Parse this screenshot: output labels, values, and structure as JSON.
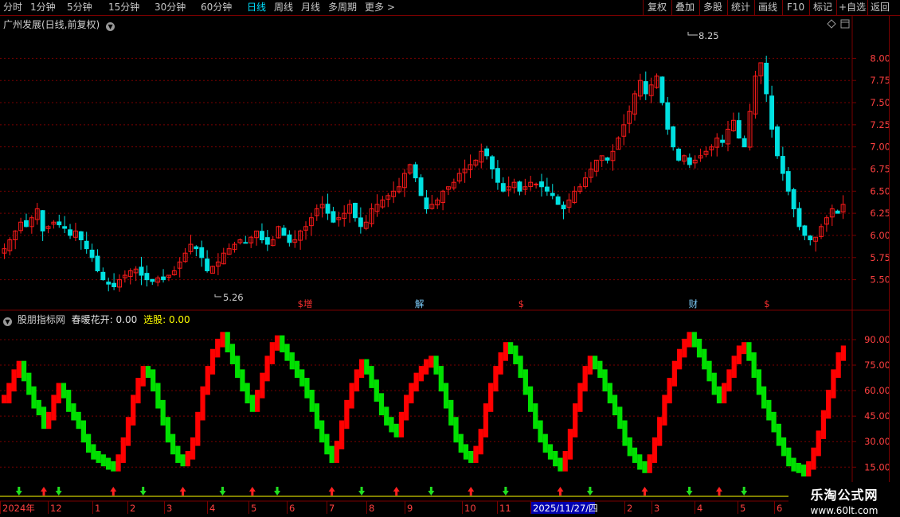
{
  "toolbar": {
    "periods": [
      "分时",
      "1分钟",
      "5分钟",
      "15分钟",
      "30分钟",
      "60分钟",
      "日线",
      "周线",
      "月线",
      "多周期",
      "更多"
    ],
    "active_period": "日线",
    "more_chevron": ">",
    "right_buttons": [
      "复权",
      "叠加",
      "多股",
      "统计",
      "画线",
      "F10",
      "标记",
      "+自选",
      "返回"
    ]
  },
  "price_chart": {
    "title": "广州发展(日线,前复权)",
    "y_ticks": [
      "8.00",
      "7.75",
      "7.50",
      "7.25",
      "7.00",
      "6.75",
      "6.50",
      "6.25",
      "6.00",
      "5.75",
      "5.50"
    ],
    "high_label": "8.25",
    "low_label": "5.26",
    "event_markers": [
      {
        "text": "$增",
        "pos": 0.36
      },
      {
        "text": "解",
        "pos": 0.495
      },
      {
        "text": "$",
        "pos": 0.615
      },
      {
        "text": "财",
        "pos": 0.818
      },
      {
        "text": "$",
        "pos": 0.905
      }
    ]
  },
  "indicator": {
    "name": "股朋指标网",
    "series_label": "春暖花开",
    "series_value": "0.00",
    "select_label": "选股",
    "select_value": "0.00",
    "y_ticks": [
      "90.00",
      "75.00",
      "60.00",
      "45.00",
      "30.00",
      "15.00"
    ]
  },
  "time_axis": {
    "labels": [
      "2024年",
      "12",
      "1",
      "2",
      "3",
      "4",
      "5",
      "6",
      "7",
      "8",
      "9",
      "10",
      "11",
      "2025/11/27/四",
      "2",
      "3",
      "4",
      "5",
      "6"
    ],
    "highlighted": "2025/11/27/四"
  },
  "watermark": {
    "title": "乐淘公式网",
    "url": "www.60lt.com"
  },
  "colors": {
    "up": "#ff1a1a",
    "down": "#00e0e0",
    "ind_up": "#ff0000",
    "ind_down": "#00e000",
    "grid": "#7a0000",
    "axis_text": "#ff4040",
    "active": "#00e0ff"
  },
  "chart_data": [
    {
      "type": "candlestick",
      "title": "广州发展(日线,前复权)",
      "ylim": [
        5.2,
        8.3
      ],
      "y_ticks": [
        5.5,
        5.75,
        6.0,
        6.25,
        6.5,
        6.75,
        7.0,
        7.25,
        7.5,
        7.75,
        8.0
      ],
      "annotations": [
        {
          "label": "8.25",
          "value": 8.25,
          "kind": "high"
        },
        {
          "label": "5.26",
          "value": 5.26,
          "kind": "low"
        }
      ],
      "close_series": [
        5.85,
        5.95,
        6.05,
        6.15,
        6.1,
        6.2,
        6.3,
        6.05,
        6.1,
        6.15,
        6.12,
        6.08,
        6.0,
        6.05,
        5.95,
        5.85,
        5.75,
        5.6,
        5.5,
        5.45,
        5.42,
        5.5,
        5.55,
        5.6,
        5.62,
        5.55,
        5.5,
        5.48,
        5.52,
        5.5,
        5.55,
        5.6,
        5.7,
        5.8,
        5.9,
        5.85,
        5.75,
        5.6,
        5.65,
        5.7,
        5.8,
        5.85,
        5.9,
        5.95,
        5.92,
        5.98,
        6.05,
        5.95,
        5.9,
        5.95,
        6.1,
        6.0,
        5.92,
        5.95,
        6.05,
        6.1,
        6.2,
        6.3,
        6.35,
        6.25,
        6.15,
        6.2,
        6.25,
        6.35,
        6.2,
        6.1,
        6.15,
        6.3,
        6.35,
        6.4,
        6.45,
        6.5,
        6.55,
        6.7,
        6.8,
        6.65,
        6.45,
        6.3,
        6.35,
        6.4,
        6.5,
        6.55,
        6.6,
        6.7,
        6.75,
        6.8,
        6.85,
        6.95,
        6.9,
        6.75,
        6.6,
        6.5,
        6.55,
        6.6,
        6.5,
        6.55,
        6.6,
        6.58,
        6.55,
        6.5,
        6.45,
        6.35,
        6.3,
        6.4,
        6.5,
        6.55,
        6.65,
        6.75,
        6.85,
        6.9,
        6.85,
        6.95,
        7.1,
        7.25,
        7.4,
        7.6,
        7.75,
        7.6,
        7.7,
        7.8,
        7.5,
        7.2,
        7.0,
        6.85,
        6.9,
        6.8,
        6.85,
        6.9,
        6.95,
        7.0,
        7.1,
        7.05,
        7.2,
        7.3,
        7.1,
        7.0,
        7.4,
        7.8,
        7.95,
        7.6,
        7.2,
        6.9,
        6.7,
        6.5,
        6.3,
        6.1,
        6.0,
        5.95,
        5.98,
        6.1,
        6.2,
        6.3,
        6.25,
        6.35
      ]
    },
    {
      "type": "line",
      "title": "股朋指标网",
      "ylim": [
        10,
        97
      ],
      "y_ticks": [
        15,
        30,
        45,
        60,
        75,
        90
      ],
      "series": [
        {
          "name": "春暖花开",
          "values": [
            55,
            62,
            70,
            75,
            68,
            60,
            52,
            48,
            40,
            45,
            55,
            62,
            58,
            50,
            45,
            40,
            32,
            26,
            22,
            20,
            18,
            16,
            15,
            20,
            30,
            42,
            55,
            65,
            72,
            70,
            62,
            52,
            42,
            32,
            25,
            20,
            18,
            22,
            30,
            45,
            60,
            72,
            82,
            88,
            92,
            85,
            78,
            70,
            62,
            55,
            50,
            58,
            68,
            78,
            86,
            90,
            85,
            80,
            75,
            70,
            65,
            58,
            50,
            40,
            32,
            25,
            20,
            28,
            40,
            52,
            62,
            70,
            76,
            72,
            64,
            56,
            48,
            42,
            38,
            35,
            45,
            55,
            62,
            68,
            72,
            76,
            78,
            72,
            62,
            52,
            42,
            32,
            26,
            22,
            20,
            25,
            35,
            50,
            62,
            72,
            80,
            86,
            84,
            78,
            70,
            60,
            50,
            40,
            32,
            26,
            22,
            18,
            15,
            22,
            35,
            50,
            62,
            72,
            78,
            75,
            70,
            62,
            55,
            48,
            40,
            30,
            24,
            20,
            16,
            14,
            20,
            30,
            42,
            55,
            65,
            75,
            82,
            88,
            92,
            88,
            82,
            75,
            68,
            60,
            55,
            62,
            70,
            78,
            84,
            86,
            80,
            70,
            60,
            52,
            45,
            38,
            30,
            24,
            18,
            15,
            14,
            12,
            16,
            24,
            34,
            46,
            58,
            70,
            80,
            84
          ]
        }
      ]
    }
  ]
}
